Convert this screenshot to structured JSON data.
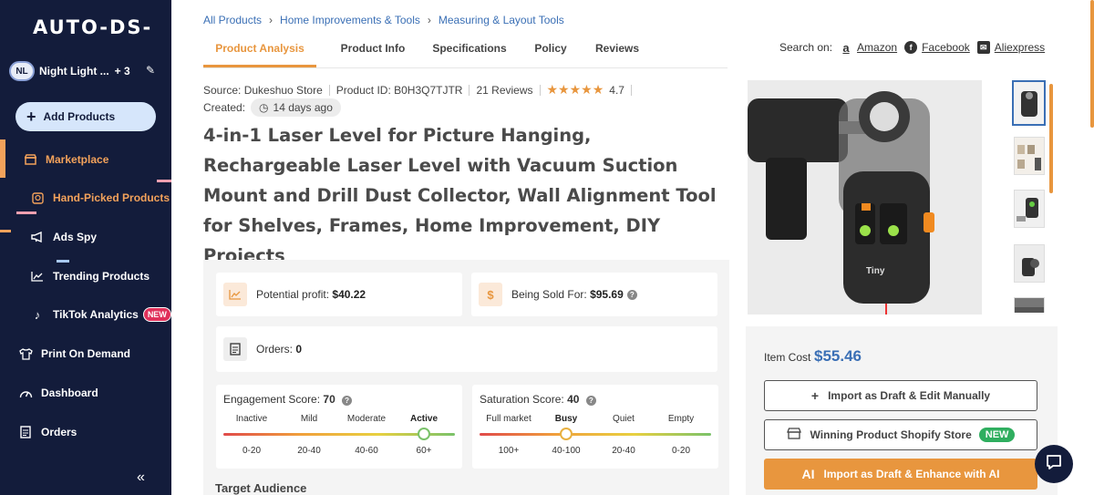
{
  "app": {
    "logo": "AUTO-DS-"
  },
  "sidebar": {
    "store": {
      "avatar": "NL",
      "name": "Night Light ...",
      "count": "+ 3"
    },
    "add_products": "Add Products",
    "items": [
      {
        "label": "Marketplace",
        "icon": "store-icon"
      },
      {
        "label": "Hand-Picked Products",
        "icon": "badge-icon"
      },
      {
        "label": "Ads Spy",
        "icon": "megaphone-icon"
      },
      {
        "label": "Trending Products",
        "icon": "trend-icon"
      },
      {
        "label": "TikTok Analytics",
        "icon": "tiktok-icon",
        "badge": "NEW"
      },
      {
        "label": "Print On Demand",
        "icon": "shirt-icon"
      },
      {
        "label": "Dashboard",
        "icon": "gauge-icon"
      },
      {
        "label": "Orders",
        "icon": "orders-icon"
      }
    ],
    "collapse": "«"
  },
  "breadcrumb": [
    "All Products",
    "Home Improvements & Tools",
    "Measuring & Layout Tools"
  ],
  "tabs": [
    "Product Analysis",
    "Product Info",
    "Specifications",
    "Policy",
    "Reviews"
  ],
  "search_on": {
    "label": "Search on:",
    "links": [
      "Amazon",
      "Facebook",
      "Aliexpress"
    ]
  },
  "meta": {
    "source": "Source: Dukeshuo Store",
    "product_id": "Product ID: B0H3Q7TJTR",
    "reviews": "21 Reviews",
    "rating": "4.7",
    "created_label": "Created:",
    "created_value": "14 days ago"
  },
  "product_title": "4-in-1 Laser Level for Picture Hanging, Rechargeable Laser Level with Vacuum Suction Mount and Drill Dust Collector, Wall Alignment Tool for Shelves, Frames, Home Improvement, DIY Projects",
  "stats": {
    "profit_label": "Potential profit:",
    "profit_value": "$40.22",
    "sold_label": "Being Sold For:",
    "sold_value": "$95.69",
    "orders_label": "Orders:",
    "orders_value": "0"
  },
  "engagement": {
    "title": "Engagement Score:",
    "value": "70",
    "labels": [
      "Inactive",
      "Mild",
      "Moderate",
      "Active"
    ],
    "ranges": [
      "0-20",
      "20-40",
      "40-60",
      "60+"
    ],
    "selected": 3
  },
  "saturation": {
    "title": "Saturation Score:",
    "value": "40",
    "labels": [
      "Full market",
      "Busy",
      "Quiet",
      "Empty"
    ],
    "ranges": [
      "100+",
      "40-100",
      "20-40",
      "0-20"
    ],
    "selected": 1
  },
  "target_audience": "Target Audience",
  "cost": {
    "label": "Item Cost",
    "value": "$55.46"
  },
  "buttons": {
    "import_draft": "Import as Draft & Edit Manually",
    "shopify": "Winning Product Shopify Store",
    "shopify_badge": "NEW",
    "enhance": "Import as Draft & Enhance with AI"
  },
  "colors": {
    "accent": "#e8963e",
    "sidebar": "#131c3b",
    "link": "#3a6fb5"
  }
}
